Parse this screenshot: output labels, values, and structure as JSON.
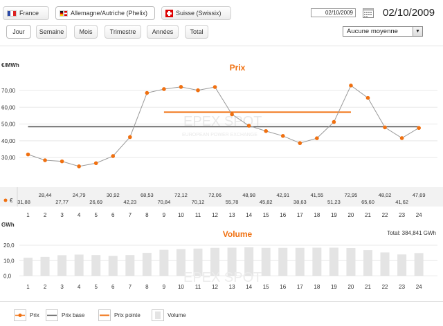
{
  "market_tabs": [
    {
      "label": "France",
      "active": false
    },
    {
      "label": "Allemagne/Autriche (Phelix)",
      "active": true
    },
    {
      "label": "Suisse (Swissix)",
      "active": false
    }
  ],
  "period_tabs": [
    {
      "label": "Jour",
      "active": true
    },
    {
      "label": "Semaine",
      "active": false
    },
    {
      "label": "Mois",
      "active": false
    },
    {
      "label": "Trimestre",
      "active": false
    },
    {
      "label": "Années",
      "active": false
    },
    {
      "label": "Total",
      "active": false
    }
  ],
  "date_input": {
    "value": "02/10/2009"
  },
  "date_display": "02/10/2009",
  "average_select": {
    "selected": "Aucune moyenne"
  },
  "colors": {
    "price": "#f07010",
    "base": "#555555",
    "peak": "#f07010",
    "volume": "#e4e4e4",
    "price_line": "#999999"
  },
  "watermark": {
    "text": "EPEX SPOT",
    "subtext": "EUROPEAN POWER EXCHANGE"
  },
  "chart_data": [
    {
      "type": "line",
      "title": "Prix",
      "ylabel": "€/MWh",
      "ylim": [
        20,
        80
      ],
      "yticks": [
        "70,00",
        "60,00",
        "50,00",
        "40,00",
        "30,00"
      ],
      "x": [
        "1",
        "2",
        "3",
        "4",
        "5",
        "6",
        "7",
        "8",
        "9",
        "10",
        "11",
        "12",
        "13",
        "14",
        "15",
        "16",
        "17",
        "18",
        "19",
        "20",
        "21",
        "22",
        "23",
        "24"
      ],
      "series": [
        {
          "name": "Prix",
          "values": [
            31.88,
            28.44,
            27.77,
            24.79,
            26.69,
            30.92,
            42.23,
            68.53,
            70.84,
            72.12,
            70.12,
            72.06,
            55.78,
            48.98,
            45.82,
            42.91,
            38.63,
            41.55,
            51.23,
            72.95,
            65.6,
            48.02,
            41.62,
            47.69
          ]
        }
      ],
      "value_labels": [
        "31,88",
        "28,44",
        "27,77",
        "24,79",
        "26,69",
        "30,92",
        "42,23",
        "68,53",
        "70,84",
        "72,12",
        "70,12",
        "72,06",
        "55,78",
        "48,98",
        "45,82",
        "42,91",
        "38,63",
        "41,55",
        "51,23",
        "72,95",
        "65,60",
        "48,02",
        "41,62",
        "47,69"
      ],
      "value_row_label": "€",
      "base_value": 48.4,
      "peak_value": 57.1,
      "peak_range": [
        9,
        20
      ]
    },
    {
      "type": "bar",
      "title": "Volume",
      "ylabel": "GWh",
      "ylim": [
        0,
        20
      ],
      "yticks": [
        "20,0",
        "10,0",
        "0,0"
      ],
      "total_label": "Total:  384,841 GWh",
      "x": [
        "1",
        "2",
        "3",
        "4",
        "5",
        "6",
        "7",
        "8",
        "9",
        "10",
        "11",
        "12",
        "13",
        "14",
        "15",
        "16",
        "17",
        "18",
        "19",
        "20",
        "21",
        "22",
        "23",
        "24"
      ],
      "values": [
        11.8,
        12.4,
        13.5,
        13.9,
        13.6,
        13.0,
        13.6,
        15.0,
        17.0,
        17.4,
        17.8,
        18.3,
        18.4,
        18.6,
        18.3,
        18.3,
        18.3,
        18.4,
        18.4,
        18.2,
        16.8,
        15.3,
        14.0,
        14.9
      ]
    }
  ],
  "legend": [
    {
      "label": "Prix",
      "icon": "price-dot-line"
    },
    {
      "label": "Prix base",
      "icon": "base-line"
    },
    {
      "label": "Prix pointe",
      "icon": "peak-line"
    },
    {
      "label": "Volume",
      "icon": "volume-bar"
    }
  ]
}
